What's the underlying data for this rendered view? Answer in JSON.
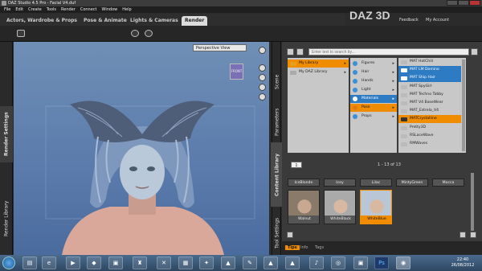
{
  "window": {
    "title": "DAZ Studio 4.5 Pro - Facial V4.duf"
  },
  "menu": [
    "File",
    "Edit",
    "Create",
    "Tools",
    "Render",
    "Connect",
    "Window",
    "Help"
  ],
  "brand": {
    "logo": "DAZ 3D",
    "links": [
      "Feedback",
      "My Account"
    ]
  },
  "tabs": [
    {
      "label": "Actors, Wardrobe & Props",
      "active": false
    },
    {
      "label": "Pose & Animate",
      "active": false
    },
    {
      "label": "Lights & Cameras",
      "active": false
    },
    {
      "label": "Render",
      "active": true
    }
  ],
  "left_tabs": [
    "Render Settings",
    "Render Library"
  ],
  "viewport": {
    "view_select": "Perspective View",
    "cube_label": "FRONT"
  },
  "right_tabs": [
    "Scene",
    "Parameters",
    "Content Library",
    "Tool Settings"
  ],
  "search": {
    "placeholder": "Enter text to search by..."
  },
  "library": {
    "col1": [
      {
        "label": "My Library",
        "selected": true
      },
      {
        "label": "My DAZ Library",
        "selected": false
      }
    ],
    "col2": [
      {
        "label": "Figures",
        "selected": false
      },
      {
        "label": "Hair",
        "selected": false
      },
      {
        "label": "Hands",
        "selected": false
      },
      {
        "label": "Light",
        "selected": false
      },
      {
        "label": "Materials",
        "selected": true
      },
      {
        "label": "Pose",
        "selected": false
      },
      {
        "label": "Props",
        "selected": false
      }
    ],
    "col3": [
      {
        "label": "MAT HotChili",
        "style": "plain"
      },
      {
        "label": "MAT LM Domino",
        "style": "blue"
      },
      {
        "label": "MAT Ship Hair",
        "style": "blue"
      },
      {
        "label": "MAT SpyGirl",
        "style": "plain"
      },
      {
        "label": "MAT Techno Tabby",
        "style": "plain"
      },
      {
        "label": "MAT V4 BaseWear",
        "style": "plain"
      },
      {
        "label": "MAT_Estrela_V4",
        "style": "plain"
      },
      {
        "label": "MATCrystalline",
        "style": "orange"
      },
      {
        "label": "Pretty3D",
        "style": "plain"
      },
      {
        "label": "RSLaceWave",
        "style": "plain"
      },
      {
        "label": "RMWaves",
        "style": "plain"
      }
    ]
  },
  "pager": {
    "page": "1",
    "range": "1 - 13 of 13"
  },
  "thumbs_row1": [
    "IceBlonde",
    "Icey",
    "Lilac",
    "MintyGreen",
    "Mocca"
  ],
  "thumbs_row2": [
    "Walnut",
    "WhiteBlack",
    "WhiteBlue"
  ],
  "selected_thumb": "WhiteBlue",
  "bottom_tabs": [
    {
      "label": "Tips",
      "active": true
    },
    {
      "label": "Info",
      "active": false
    },
    {
      "label": "Tags",
      "active": false
    }
  ],
  "taskbar": {
    "time": "22:40",
    "date": "26/08/2012"
  }
}
